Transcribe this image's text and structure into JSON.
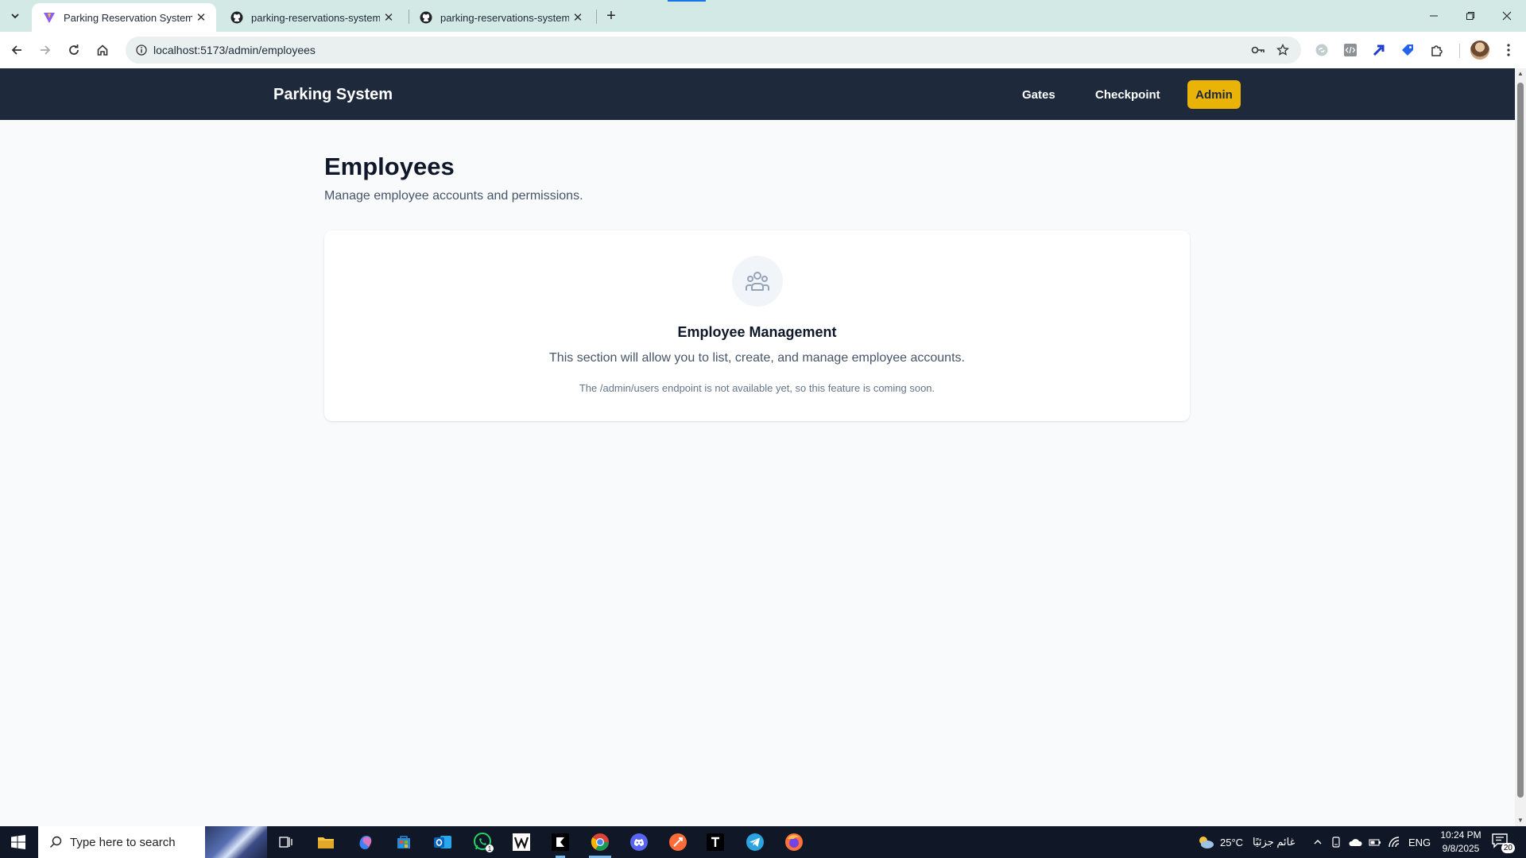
{
  "browser": {
    "tabs": [
      {
        "title": "Parking Reservation System",
        "active": true
      },
      {
        "title": "parking-reservations-system-ta",
        "active": false
      },
      {
        "title": "parking-reservations-system-ta",
        "active": false
      }
    ],
    "url": "localhost:5173/admin/employees"
  },
  "app": {
    "brand": "Parking System",
    "nav": {
      "gates": "Gates",
      "checkpoint": "Checkpoint",
      "admin": "Admin"
    },
    "colors": {
      "nav_bg": "#1e293b",
      "accent": "#eab308"
    }
  },
  "page": {
    "title": "Employees",
    "subtitle": "Manage employee accounts and permissions.",
    "card": {
      "icon": "users-icon",
      "title": "Employee Management",
      "text": "This section will allow you to list, create, and manage employee accounts.",
      "note": "The /admin/users endpoint is not available yet, so this feature is coming soon."
    }
  },
  "taskbar": {
    "search_placeholder": "Type here to search",
    "whatsapp_badge": "1",
    "weather": {
      "temp": "25°C",
      "label": "غائم جزئيًا"
    },
    "language": "ENG",
    "time": "10:24 PM",
    "date": "9/8/2025",
    "notifications": "20"
  }
}
